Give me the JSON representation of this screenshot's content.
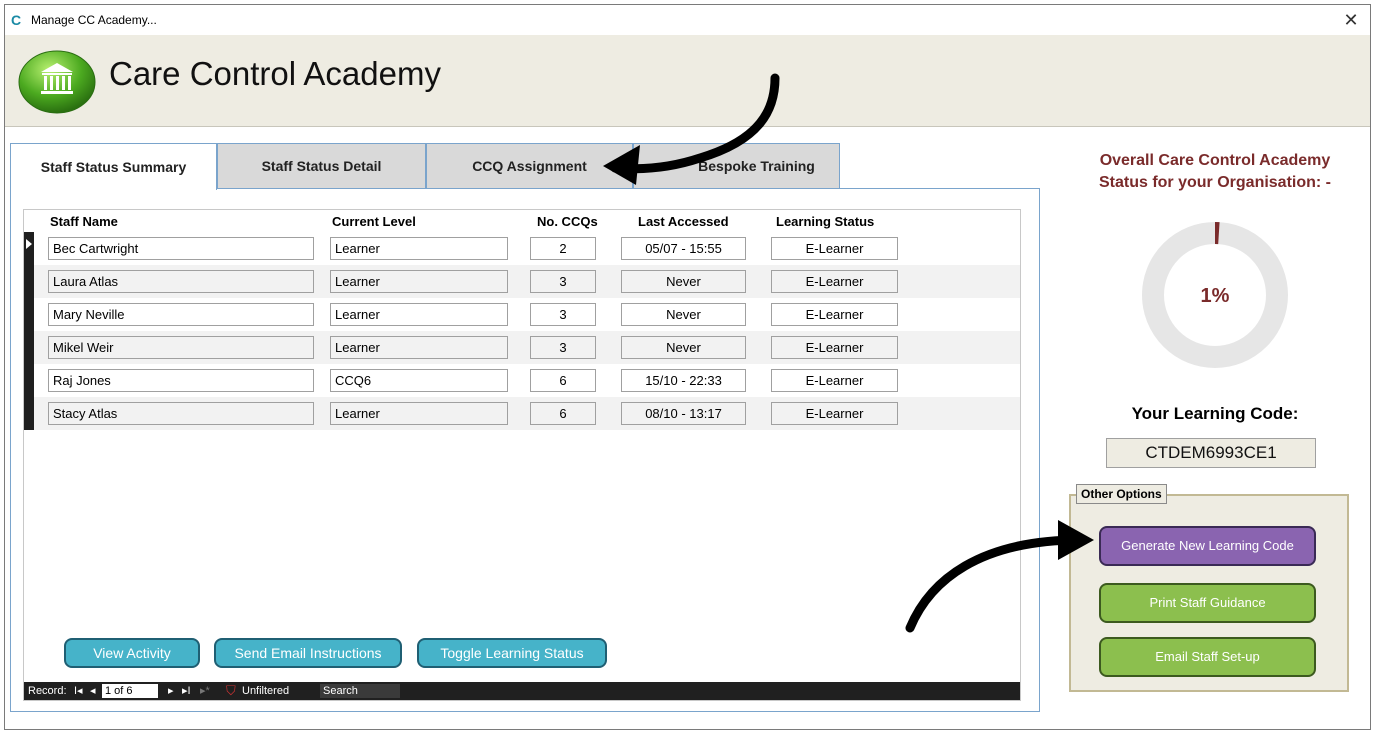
{
  "window": {
    "title": "Manage CC Academy...",
    "app_icon": "C",
    "close": "✕"
  },
  "header": {
    "title": "Care Control Academy",
    "logo_icon": "bank-icon"
  },
  "tabs": [
    {
      "label": "Staff Status Summary",
      "active": true
    },
    {
      "label": "Staff Status Detail",
      "active": false
    },
    {
      "label": "CCQ Assignment",
      "active": false
    },
    {
      "label": "Bespoke Training",
      "active": false
    }
  ],
  "table": {
    "columns": [
      "Staff Name",
      "Current Level",
      "No. CCQs",
      "Last Accessed",
      "Learning Status"
    ],
    "rows": [
      {
        "name": "Bec Cartwright",
        "level": "Learner",
        "ccqs": "2",
        "accessed": "05/07 - 15:55",
        "status": "E-Learner"
      },
      {
        "name": "Laura Atlas",
        "level": "Learner",
        "ccqs": "3",
        "accessed": "Never",
        "status": "E-Learner"
      },
      {
        "name": "Mary Neville",
        "level": "Learner",
        "ccqs": "3",
        "accessed": "Never",
        "status": "E-Learner"
      },
      {
        "name": "Mikel Weir",
        "level": "Learner",
        "ccqs": "3",
        "accessed": "Never",
        "status": "E-Learner"
      },
      {
        "name": "Raj Jones",
        "level": "CCQ6",
        "ccqs": "6",
        "accessed": "15/10 - 22:33",
        "status": "E-Learner"
      },
      {
        "name": "Stacy Atlas",
        "level": "Learner",
        "ccqs": "6",
        "accessed": "08/10 - 13:17",
        "status": "E-Learner"
      }
    ]
  },
  "actions": {
    "view_activity": "View Activity",
    "send_email": "Send Email Instructions",
    "toggle_status": "Toggle Learning Status"
  },
  "navigator": {
    "record_label": "Record:",
    "first": "I◂",
    "prev": "◂",
    "position": "1 of 6",
    "next": "▸",
    "last": "▸I",
    "new": "▸*",
    "filter": "Unfiltered",
    "search": "Search"
  },
  "status_panel": {
    "title_line1": "Overall Care Control Academy",
    "title_line2": "Status for your Organisation: -",
    "percent_label": "1%",
    "percent_value": 1,
    "learning_code_label": "Your Learning Code:",
    "learning_code": "CTDEM6993CE1"
  },
  "other_options": {
    "label": "Other Options",
    "generate": "Generate New Learning Code",
    "print": "Print Staff Guidance",
    "email": "Email Staff Set-up"
  },
  "colors": {
    "accent_teal": "#46b3c9",
    "purple": "#8a64b0",
    "green": "#8cbf4e",
    "title_red": "#7a2b2b",
    "header_bg": "#eeece2"
  }
}
